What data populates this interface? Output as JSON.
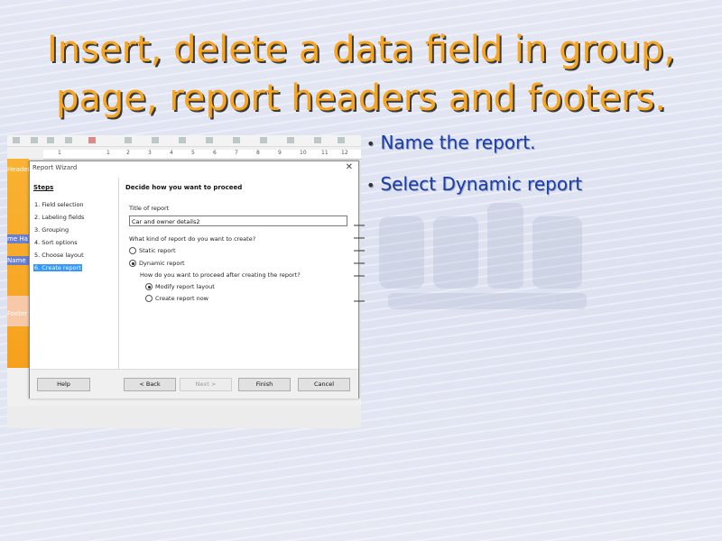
{
  "slide": {
    "title_line1": "Insert, delete a data field in group,",
    "title_line2": "page, report headers and footers.",
    "bullets": [
      "Name the report.",
      "Select Dynamic report"
    ]
  },
  "app": {
    "left_labels": [
      "Header",
      "me Ha",
      "Name",
      "Footer"
    ],
    "ruler_ticks": [
      "1",
      "1",
      "2",
      "3",
      "4",
      "5",
      "6",
      "7",
      "8",
      "9",
      "10",
      "11",
      "12"
    ]
  },
  "dialog": {
    "title": "Report Wizard",
    "close": "✕",
    "steps_heading": "Steps",
    "steps": [
      {
        "label": "1. Field selection"
      },
      {
        "label": "2. Labeling fields"
      },
      {
        "label": "3. Grouping"
      },
      {
        "label": "4. Sort options"
      },
      {
        "label": "5. Choose layout"
      },
      {
        "label": "6. Create report",
        "active": true
      }
    ],
    "heading": "Decide how you want to proceed",
    "title_label": "Title of report",
    "title_value": "Car and owner details2",
    "kind_question": "What kind of report do you want to create?",
    "kind_options": [
      {
        "label": "Static report",
        "selected": false
      },
      {
        "label": "Dynamic report",
        "selected": true
      }
    ],
    "proceed_question": "How do you want to proceed after creating the report?",
    "proceed_options": [
      {
        "label": "Modify report layout",
        "selected": true
      },
      {
        "label": "Create report now",
        "selected": false
      }
    ],
    "buttons": {
      "help": "Help",
      "back": "< Back",
      "next": "Next >",
      "finish": "Finish",
      "cancel": "Cancel"
    }
  },
  "colors": {
    "title": "#f6a522",
    "bullet": "#1a3ea8",
    "selection": "#3399ff",
    "left_bar": "#f9b233"
  }
}
